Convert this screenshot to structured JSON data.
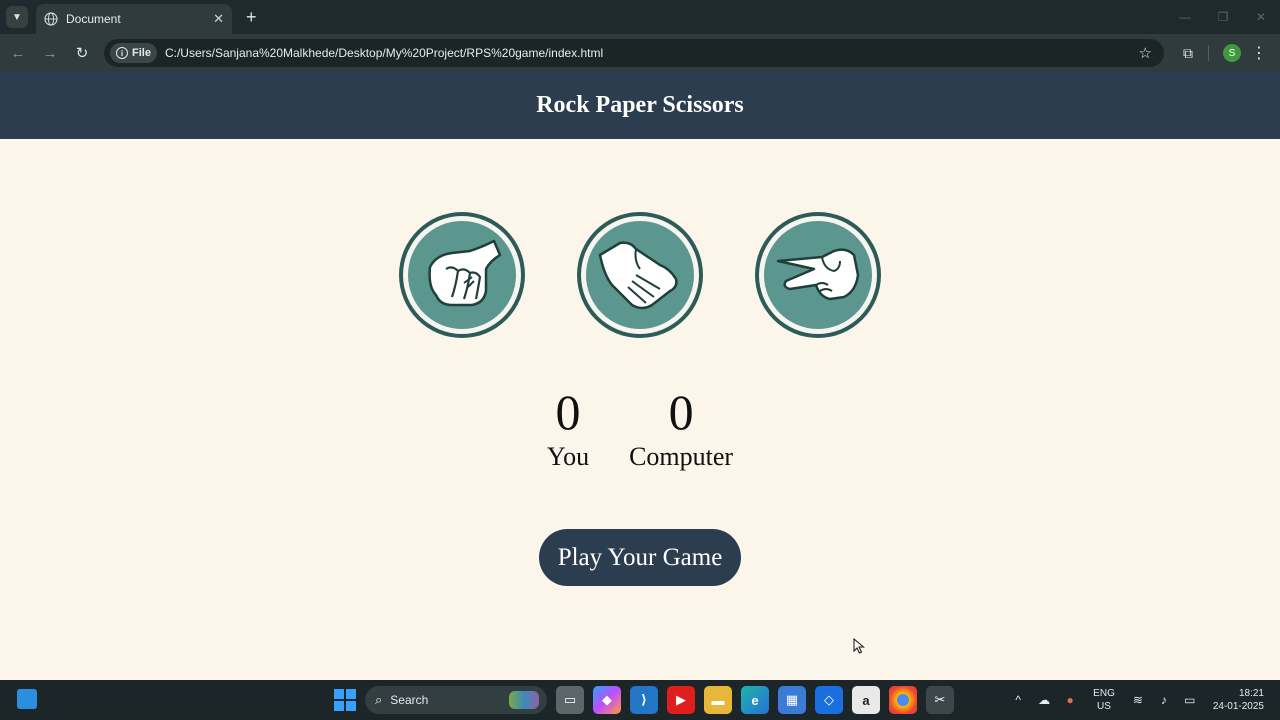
{
  "browser": {
    "tab_title": "Document",
    "tab_close": "✕",
    "new_tab": "+",
    "chip_label": "File",
    "url": "C:/Users/Sanjana%20Malkhede/Desktop/My%20Project/RPS%20game/index.html",
    "profile_initial": "S"
  },
  "page": {
    "title": "Rock Paper Scissors",
    "choices": [
      {
        "id": "rock"
      },
      {
        "id": "paper"
      },
      {
        "id": "scissors"
      }
    ],
    "scores": {
      "user_score": "0",
      "user_label": "You",
      "computer_score": "0",
      "computer_label": "Computer"
    },
    "message": "Play Your Game"
  },
  "taskbar": {
    "search_label": "Search",
    "lang_line1": "ENG",
    "lang_line2": "US",
    "time": "18:21",
    "date": "24-01-2025"
  },
  "colors": {
    "header_bg": "#2b3d4f",
    "page_bg": "#fcf5ea",
    "choice_fill": "#5b978e",
    "choice_ring": "#2d5b57"
  }
}
